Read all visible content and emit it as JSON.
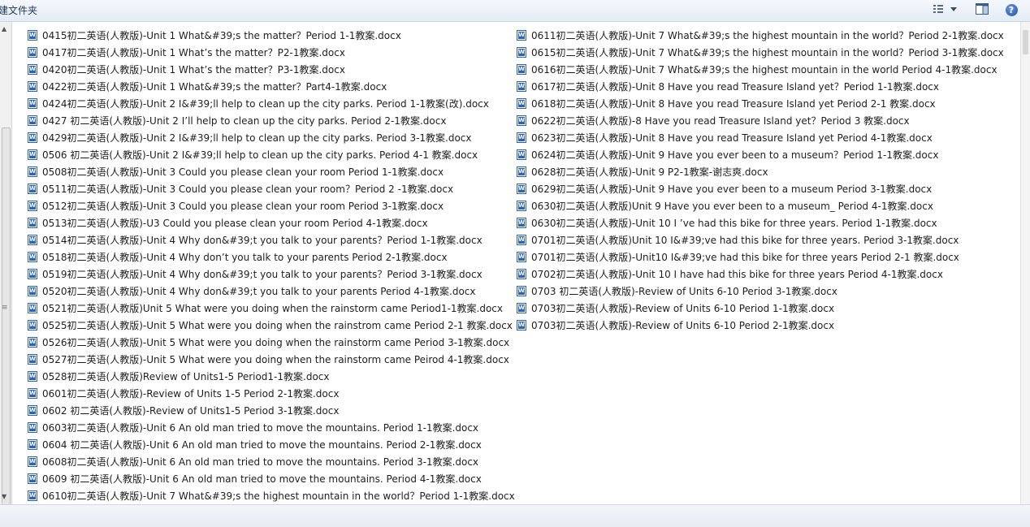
{
  "toolbar": {
    "title": "建文件夹",
    "views_icon": "views-icon",
    "preview_icon": "preview-pane-icon",
    "help_icon": "help-icon",
    "help_label": "?"
  },
  "files": {
    "column1": [
      "0415初二英语(人教版)-Unit 1 What&#39;s the matter？Period 1-1教案.docx",
      "0417初二英语(人教版)-Unit 1  What’s the matter？P2-1教案.docx",
      "0420初二英语(人教版)-Unit 1  What’s the matter？P3-1教案.docx",
      "0422初二英语(人教版)-Unit 1 What&#39;s the matter？Part4-1教案.docx",
      "0424初二英语(人教版)-Unit 2 I&#39;ll help to clean up the city parks. Period 1-1教案(改).docx",
      "0427 初二英语(人教版)-Unit 2 I’ll help to clean up the city parks. Period 2-1教案.docx",
      "0429初二英语(人教版)-Unit 2 I&#39;ll help to clean up the city parks. Period 3-1教案.docx",
      "0506 初二英语(人教版)-Unit 2 I&#39;ll help to clean up the city parks. Period 4-1 教案.docx",
      "0508初二英语(人教版)-Unit 3 Could you please clean your room Period 1-1教案.docx",
      "0511初二英语(人教版)-Unit 3 Could you please clean your room？Period 2 -1教案.docx",
      "0512初二英语(人教版)-Unit 3 Could you please clean your room Period 3-1教案.docx",
      "0513初二英语(人教版)-U3 Could you please clean your room Period 4-1教案.docx",
      "0514初二英语(人教版)-Unit 4 Why don&#39;t you talk to your parents？Period 1-1教案.docx",
      "0518初二英语(人教版)-Unit 4 Why don’t you talk to your parents Period 2-1教案.docx",
      "0519初二英语(人教版)-Unit 4 Why don&#39;t you talk to your parents？Period 3-1教案.docx",
      "0520初二英语(人教版)-Unit 4 Why don&#39;t you talk to your parents Period 4-1教案.docx",
      "0521初二英语(人教版)Unit 5 What were you doing when the rainstorm came Period1-1教案.docx",
      "0525初二英语(人教版)-Unit 5 What were you doing when the rainstrom came Period 2-1 教案.docx",
      "0526初二英语(人教版)-Unit 5 What were you doing when the rainstorm came Period 3-1教案.docx",
      "0527初二英语(人教版)-Unit 5 What were you doing when the rainstorm came Peirod 4-1教案.docx",
      "0528初二英语(人教版)Review of Units1-5 Period1-1教案.docx",
      "0601初二英语(人教版)-Review of Units 1-5 Period 2-1教案.docx",
      "0602 初二英语(人教版)-Review of Units1-5 Period 3-1教案.docx",
      "0603初二英语(人教版)-Unit 6 An old man tried to move the mountains. Period 1-1教案.docx",
      "0604 初二英语(人教版)-Unit 6 An old man tried to move the mountains. Period 2-1教案.docx",
      "0608初二英语(人教版)-Unit 6 An old man tried to move the mountains. Period 3-1教案.docx",
      "0609 初二英语(人教版)-Unit 6 An old man tried to move the mountains. Period 4-1教案.docx",
      "0610初二英语(人教版)-Unit 7 What&#39;s the highest mountain in the world？Period 1-1教案.docx"
    ],
    "column2": [
      "0611初二英语(人教版)-Unit 7 What&#39;s the highest mountain in the world？Period 2-1教案.docx",
      "0615初二英语(人教版)-Unit 7 What&#39;s the highest mountain in the world？Period 3-1教案.docx",
      "0616初二英语(人教版)-Unit 7 What&#39;s the highest mountain in the world Period 4-1教案.docx",
      "0617初二英语(人教版)-Unit 8 Have you read Treasure Island yet？Period 1-1教案.docx",
      "0618初二英语(人教版)-Unit 8 Have you read Treasure Island yet Period 2-1 教案.docx",
      "0622初二英语(人教版)-8 Have you read Treasure Island yet？Period 3 教案.docx",
      "0623初二英语(人教版)-Unit 8 Have you read Treasure Island yet Period 4-1教案.docx",
      "0624初二英语(人教版)-Unit 9 Have you ever been to a museum？Period 1-1教案.docx",
      "0628初二英语(人教版)-Unit 9 P2-1教案-谢志爽.docx",
      "0629初二英语(人教版)-Unit 9 Have you ever been to a museum Period 3-1教案.docx",
      "0630初二英语(人教版)Unit 9 Have you ever been to a museum_ Period 4-1教案.docx",
      "0630初二英语(人教版)-Unit 10 I ’ve had this bike for three years. Period 1-1教案.docx",
      "0701初二英语(人教版)Unit 10 I&#39;ve had this bike for three years. Period 3-1教案.docx",
      "0701初二英语(人教版)-Unit10  I&#39;ve had this bike for three years Period 2-1 教案.docx",
      "0702初二英语(人教版)-Unit 10 I have had this bike for three years Period 4-1教案.docx",
      "0703 初二英语(人教版)-Review of Units 6-10 Period 3-1教案.docx",
      "0703初二英语(人教版)-Review of Units 6-10 Period 1-1教案.docx",
      "0703初二英语(人教版)-Review of Units 6-10 Period 2-1教案.docx"
    ]
  }
}
